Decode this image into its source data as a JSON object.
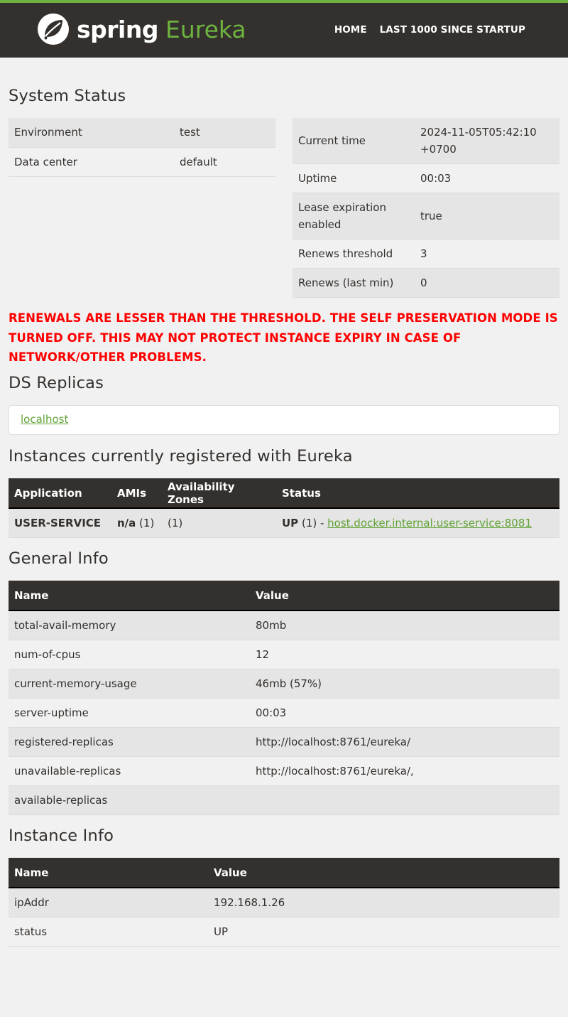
{
  "header": {
    "logo_spring": "spring",
    "logo_eureka": "Eureka",
    "nav": [
      "HOME",
      "LAST 1000 SINCE STARTUP"
    ],
    "accent_color": "#6db33f",
    "bar_color": "#34302d"
  },
  "system_status": {
    "title": "System Status",
    "left": [
      {
        "key": "Environment",
        "value": "test"
      },
      {
        "key": "Data center",
        "value": "default"
      }
    ],
    "right": [
      {
        "key": "Current time",
        "value": "2024-11-05T05:42:10 +0700"
      },
      {
        "key": "Uptime",
        "value": "00:03"
      },
      {
        "key": "Lease expiration enabled",
        "value": "true"
      },
      {
        "key": "Renews threshold",
        "value": "3"
      },
      {
        "key": "Renews (last min)",
        "value": "0"
      }
    ]
  },
  "warning": "RENEWALS ARE LESSER THAN THE THRESHOLD. THE SELF PRESERVATION MODE IS TURNED OFF. THIS MAY NOT PROTECT INSTANCE EXPIRY IN CASE OF NETWORK/OTHER PROBLEMS.",
  "ds_replicas": {
    "title": "DS Replicas",
    "link": "localhost"
  },
  "instances": {
    "title": "Instances currently registered with Eureka",
    "headers": [
      "Application",
      "AMIs",
      "Availability Zones",
      "Status"
    ],
    "row": {
      "application": "USER-SERVICE",
      "amis_bold": "n/a",
      "amis_count": " (1)",
      "zones": "(1)",
      "status_bold": "UP",
      "status_count": " (1) - ",
      "status_link": "host.docker.internal:user-service:8081"
    }
  },
  "general_info": {
    "title": "General Info",
    "headers": [
      "Name",
      "Value"
    ],
    "rows": [
      {
        "name": "total-avail-memory",
        "value": "80mb"
      },
      {
        "name": "num-of-cpus",
        "value": "12"
      },
      {
        "name": "current-memory-usage",
        "value": "46mb (57%)"
      },
      {
        "name": "server-uptime",
        "value": "00:03"
      },
      {
        "name": "registered-replicas",
        "value": "http://localhost:8761/eureka/"
      },
      {
        "name": "unavailable-replicas",
        "value": "http://localhost:8761/eureka/,"
      },
      {
        "name": "available-replicas",
        "value": ""
      }
    ]
  },
  "instance_info": {
    "title": "Instance Info",
    "headers": [
      "Name",
      "Value"
    ],
    "rows": [
      {
        "name": "ipAddr",
        "value": "192.168.1.26"
      },
      {
        "name": "status",
        "value": "UP"
      }
    ]
  }
}
